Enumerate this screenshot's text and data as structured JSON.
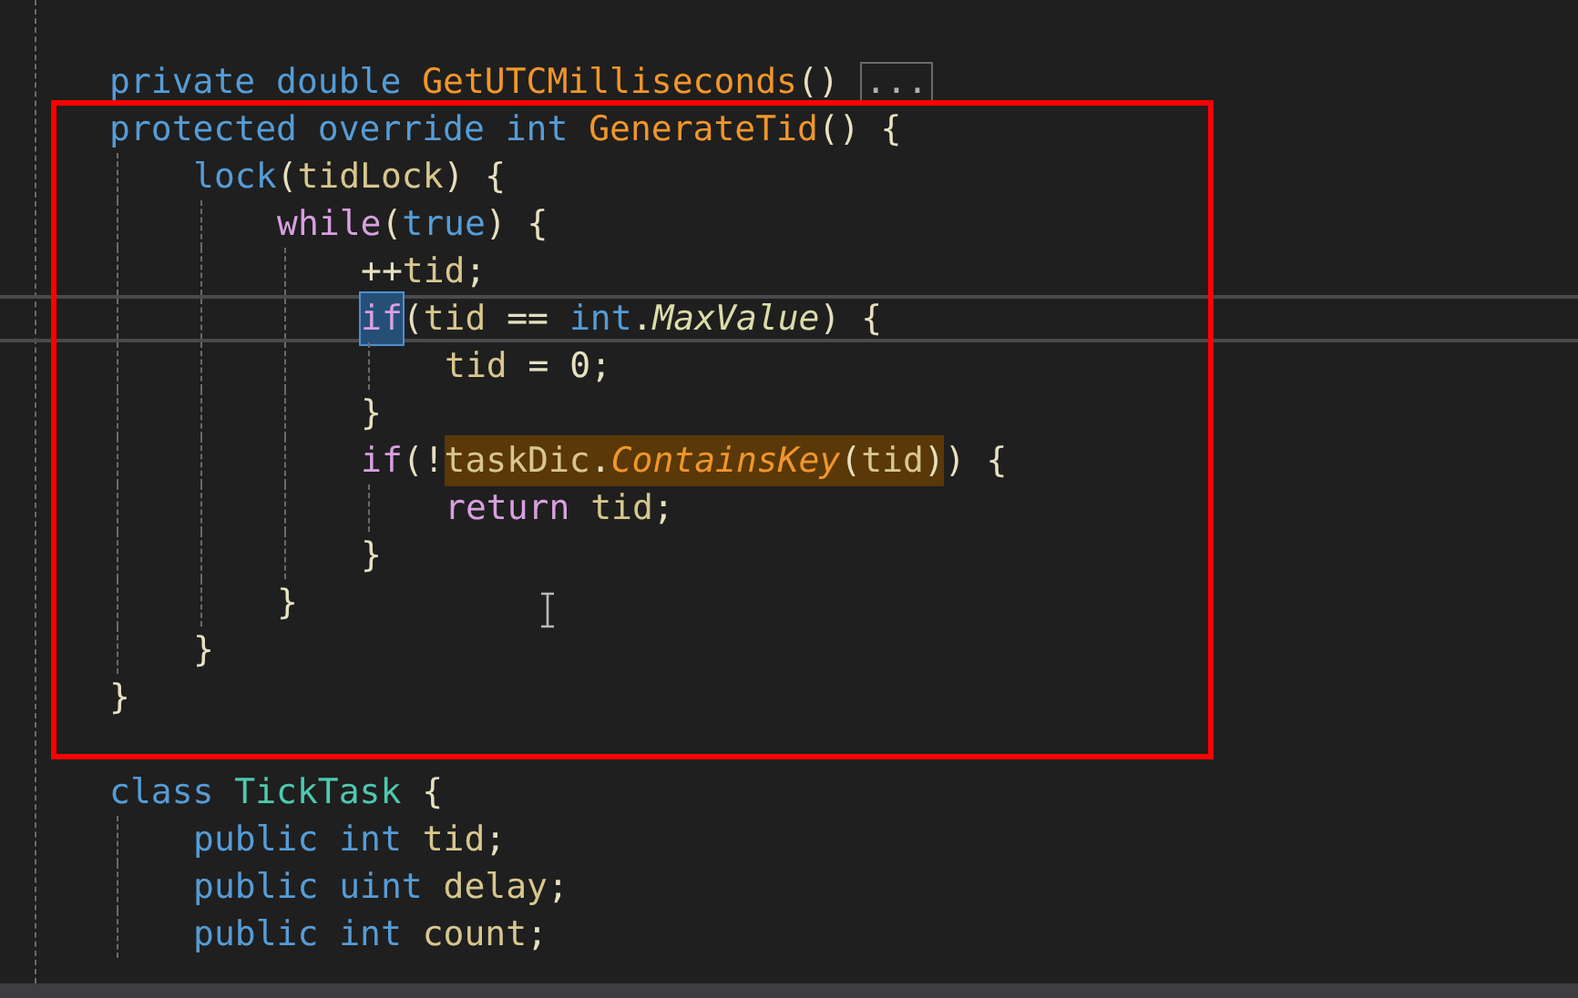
{
  "editor": {
    "lines": [
      {
        "tokens": [
          {
            "text": "private double ",
            "kind": "keyword"
          },
          {
            "text": "GetUTCMilliseconds",
            "kind": "method"
          },
          {
            "text": "() ",
            "kind": "punct"
          },
          {
            "text": "...",
            "kind": "fold"
          }
        ]
      },
      {
        "tokens": [
          {
            "text": "protected override int ",
            "kind": "keyword"
          },
          {
            "text": "GenerateTid",
            "kind": "method"
          },
          {
            "text": "() {",
            "kind": "punct"
          }
        ],
        "children": [
          {
            "tokens": [
              {
                "text": "lock",
                "kind": "keyword"
              },
              {
                "text": "(",
                "kind": "punct"
              },
              {
                "text": "tidLock",
                "kind": "variable"
              },
              {
                "text": ") {",
                "kind": "punct"
              }
            ],
            "children": [
              {
                "tokens": [
                  {
                    "text": "while",
                    "kind": "control"
                  },
                  {
                    "text": "(",
                    "kind": "punct"
                  },
                  {
                    "text": "true",
                    "kind": "keyword"
                  },
                  {
                    "text": ") {",
                    "kind": "punct"
                  }
                ],
                "children": [
                  {
                    "tokens": [
                      {
                        "text": "++",
                        "kind": "punct"
                      },
                      {
                        "text": "tid",
                        "kind": "variable"
                      },
                      {
                        "text": ";",
                        "kind": "punct"
                      }
                    ]
                  },
                  {
                    "current": true,
                    "tokens": [
                      {
                        "text": "if",
                        "kind": "control",
                        "selected": true
                      },
                      {
                        "text": "(",
                        "kind": "punct"
                      },
                      {
                        "text": "tid",
                        "kind": "variable"
                      },
                      {
                        "text": " == ",
                        "kind": "punct"
                      },
                      {
                        "text": "int",
                        "kind": "keyword"
                      },
                      {
                        "text": ".",
                        "kind": "punct"
                      },
                      {
                        "text": "MaxValue",
                        "kind": "property"
                      },
                      {
                        "text": ") {",
                        "kind": "punct"
                      }
                    ],
                    "children": [
                      {
                        "tokens": [
                          {
                            "text": "tid",
                            "kind": "variable"
                          },
                          {
                            "text": " = 0;",
                            "kind": "punct"
                          }
                        ]
                      }
                    ]
                  },
                  {
                    "tokens": [
                      {
                        "text": "}",
                        "kind": "punct"
                      }
                    ]
                  },
                  {
                    "tokens": [
                      {
                        "text": "if",
                        "kind": "control"
                      },
                      {
                        "text": "(!",
                        "kind": "punct"
                      },
                      {
                        "text": "taskDic",
                        "kind": "variable",
                        "highlighted": true
                      },
                      {
                        "text": ".",
                        "kind": "punct",
                        "highlighted": true
                      },
                      {
                        "text": "ContainsKey",
                        "kind": "method-call",
                        "highlighted": true
                      },
                      {
                        "text": "(",
                        "kind": "punct",
                        "highlighted": true
                      },
                      {
                        "text": "tid",
                        "kind": "variable",
                        "highlighted": true
                      },
                      {
                        "text": ")",
                        "kind": "punct",
                        "highlighted": true
                      },
                      {
                        "text": ") {",
                        "kind": "punct"
                      }
                    ],
                    "children": [
                      {
                        "tokens": [
                          {
                            "text": "return ",
                            "kind": "control"
                          },
                          {
                            "text": "tid",
                            "kind": "variable"
                          },
                          {
                            "text": ";",
                            "kind": "punct"
                          }
                        ]
                      }
                    ]
                  },
                  {
                    "tokens": [
                      {
                        "text": "}",
                        "kind": "punct"
                      }
                    ]
                  }
                ]
              },
              {
                "tokens": [
                  {
                    "text": "}",
                    "kind": "punct"
                  }
                ]
              }
            ]
          },
          {
            "tokens": [
              {
                "text": "}",
                "kind": "punct"
              }
            ]
          }
        ]
      },
      {
        "tokens": [
          {
            "text": "}",
            "kind": "punct"
          }
        ]
      },
      {
        "blank_before": true,
        "tokens": [
          {
            "text": "class ",
            "kind": "keyword"
          },
          {
            "text": "TickTask",
            "kind": "type"
          },
          {
            "text": " {",
            "kind": "punct"
          }
        ],
        "children": [
          {
            "tokens": [
              {
                "text": "public int ",
                "kind": "keyword"
              },
              {
                "text": "tid",
                "kind": "variable"
              },
              {
                "text": ";",
                "kind": "punct"
              }
            ]
          },
          {
            "tokens": [
              {
                "text": "public uint ",
                "kind": "keyword"
              },
              {
                "text": "delay",
                "kind": "variable"
              },
              {
                "text": ";",
                "kind": "punct"
              }
            ]
          },
          {
            "tokens": [
              {
                "text": "public int ",
                "kind": "keyword"
              },
              {
                "text": "count",
                "kind": "variable"
              },
              {
                "text": ";",
                "kind": "punct"
              }
            ]
          }
        ]
      }
    ]
  }
}
